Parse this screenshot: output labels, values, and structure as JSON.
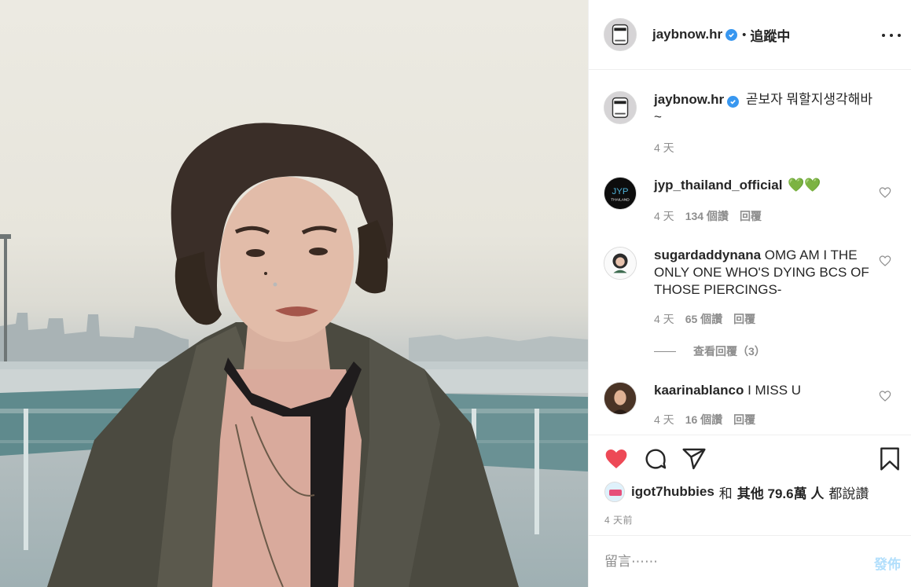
{
  "post": {
    "author": {
      "username": "jaybnow.hr",
      "separator": "•",
      "follow_status": "追蹤中",
      "verified": true
    },
    "caption": {
      "username": "jaybnow.hr",
      "text": "곧보자 뭐할지생각해바\n~",
      "time": "4 天"
    }
  },
  "comments": [
    {
      "username": "jyp_thailand_official",
      "text": "💚💚",
      "time": "4 天",
      "likes": "134 個讚",
      "reply": "回覆",
      "avatar_text": "JYP",
      "avatar_sub": "THAILAND"
    },
    {
      "username": "sugardaddynana",
      "text": "OMG AM I THE ONLY ONE WHO'S DYING BCS OF THOSE PIERCINGS-",
      "time": "4 天",
      "likes": "65 個讚",
      "reply": "回覆",
      "view_replies": "查看回覆（3）"
    },
    {
      "username": "kaarinablanco",
      "text": "I MISS U",
      "time": "4 天",
      "likes": "16 個讚",
      "reply": "回覆"
    }
  ],
  "actions": {
    "liked": true,
    "icons": [
      "heart-icon",
      "comment-icon",
      "share-icon",
      "bookmark-icon"
    ]
  },
  "likes_summary": {
    "username": "igot7hubbies",
    "and": "和",
    "others": "其他 79.6萬 人",
    "tail": "都說讚"
  },
  "timestamp": "4 天前",
  "composer": {
    "placeholder": "留言⋯⋯",
    "post_label": "發佈"
  },
  "colors": {
    "liked_heart": "#ed4956",
    "verified_badge": "#3897f0",
    "post_button_disabled": "#b2dffc",
    "muted_text": "#8e8e8e"
  }
}
